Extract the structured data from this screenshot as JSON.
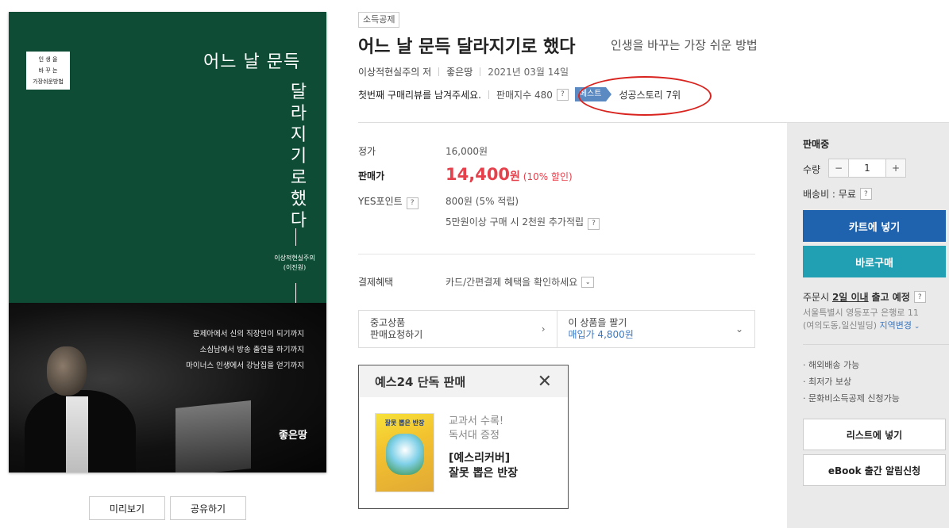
{
  "cover": {
    "badge_lines": [
      "인  생  을",
      "바  꾸  는",
      "가장쉬운방법"
    ],
    "title_horizontal": "어느 날 문득",
    "title_vertical": "달라지기로했다",
    "author_line1": "이상적현실주의",
    "author_line2": "(이진원)",
    "lines": [
      "문제아에서 신의 직장인이 되기까지",
      "소심남에서 방송 출연을 하기까지",
      "마이너스 인생에서 강남집을 얻기까지"
    ],
    "publisher": "좋은땅"
  },
  "preview_buttons": {
    "preview": "미리보기",
    "share": "공유하기"
  },
  "product": {
    "tag": "소득공제",
    "title": "어느 날 문득 달라지기로 했다",
    "subtitle": "인생을 바꾸는 가장 쉬운 방법",
    "author": "이상적현실주의 저",
    "publisher": "좋은땅",
    "date": "2021년 03월 14일",
    "review_prompt": "첫번째 구매리뷰를 남겨주세요.",
    "sales_index": "판매지수 480",
    "best_label": "베스트",
    "best_rank": "성공스토리 7위"
  },
  "price": {
    "list_label": "정가",
    "list_value": "16,000원",
    "sale_label": "판매가",
    "sale_value": "14,400",
    "sale_unit": "원",
    "discount": "(10% 할인)",
    "point_label": "YES포인트",
    "point_value": "800원 (5% 적립)",
    "extra_point": "5만원이상 구매 시 2천원 추가적립",
    "benefit_label": "결제혜택",
    "benefit_value": "카드/간편결제 혜택을 확인하세요"
  },
  "used": {
    "left_line1": "중고상품",
    "left_line2": "판매요청하기",
    "right_line1": "이 상품을 팔기",
    "right_line2": "매입가 4,800원"
  },
  "exclusive": {
    "title": "예스24 단독 판매",
    "book_title": "잘못 뽑은 반장",
    "sub1": "교과서 수록!",
    "sub2": "독서대 증정",
    "main1": "[예스리커버]",
    "main2": "잘못 뽑은 반장"
  },
  "side": {
    "status": "판매중",
    "qty_label": "수량",
    "qty_value": "1",
    "shipping": "배송비 : 무료",
    "cart": "카트에 넣기",
    "buy": "바로구매",
    "order_prefix": "주문시 ",
    "order_bold": "2일 이내",
    "order_suffix": " 출고 예정",
    "addr1": "서울특별시 영등포구 은행로 11",
    "addr2_prefix": "(여의도동,일신빌딩) ",
    "addr2_link": "지역변경",
    "bullets": [
      "· 해외배송 가능",
      "· 최저가 보상",
      "· 문화비소득공제 신청가능"
    ],
    "list_btn": "리스트에 넣기",
    "ebook_btn": "eBook 출간 알림신청"
  },
  "colors": {
    "cover_green": "#0e4c35",
    "price_red": "#e5414c",
    "cart_blue": "#1f62ad",
    "buy_teal": "#22a0b3",
    "highlight_circle": "#d8231e"
  }
}
